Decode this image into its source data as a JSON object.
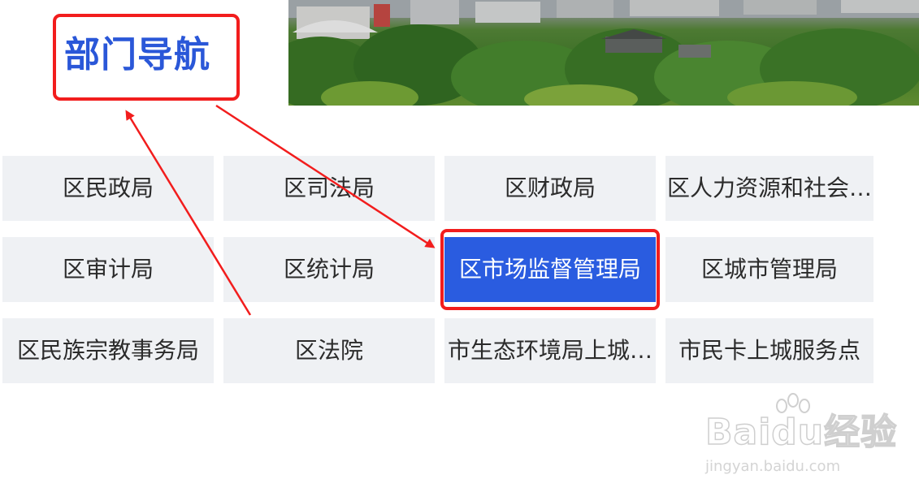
{
  "header": {
    "title": "部门导航"
  },
  "departments": [
    {
      "label": "区民政局",
      "active": false
    },
    {
      "label": "区司法局",
      "active": false
    },
    {
      "label": "区财政局",
      "active": false
    },
    {
      "label": "区人力资源和社会…",
      "active": false
    },
    {
      "label": "区审计局",
      "active": false
    },
    {
      "label": "区统计局",
      "active": false
    },
    {
      "label": "区市场监督管理局",
      "active": true
    },
    {
      "label": "区城市管理局",
      "active": false
    },
    {
      "label": "区民族宗教事务局",
      "active": false
    },
    {
      "label": "区法院",
      "active": false
    },
    {
      "label": "市生态环境局上城…",
      "active": false
    },
    {
      "label": "市民卡上城服务点",
      "active": false
    }
  ],
  "watermark": {
    "brand": "Baidu经验",
    "url": "jingyan.baidu.com"
  },
  "colors": {
    "accent": "#2a5ce0",
    "annotation": "#f21d1d",
    "cell_background": "#eff1f4"
  }
}
